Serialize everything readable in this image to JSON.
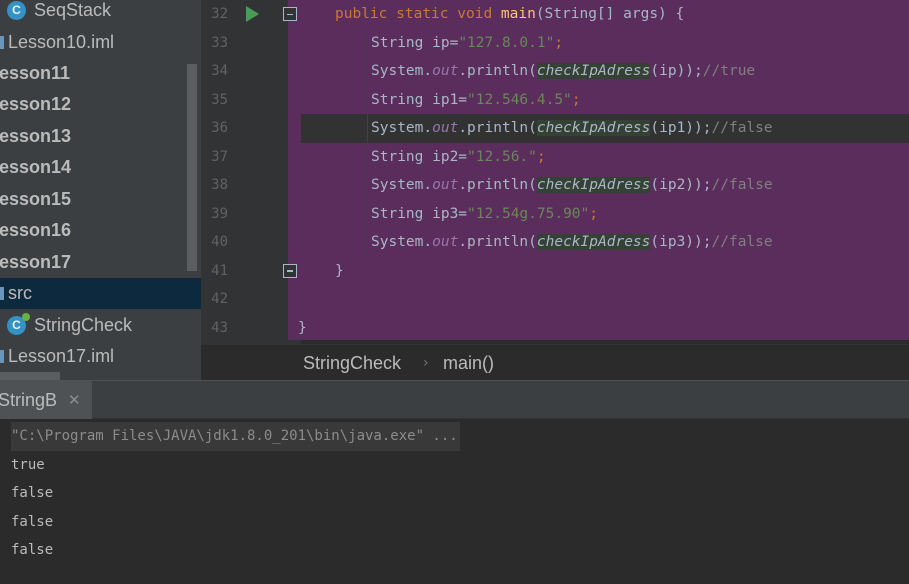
{
  "sidebar": {
    "items": [
      {
        "label": "SeqStack",
        "kind": "class"
      },
      {
        "label": "Lesson10.iml",
        "kind": "file"
      },
      {
        "label": "esson11",
        "kind": "module"
      },
      {
        "label": "esson12",
        "kind": "module"
      },
      {
        "label": "esson13",
        "kind": "module"
      },
      {
        "label": "esson14",
        "kind": "module"
      },
      {
        "label": "esson15",
        "kind": "module"
      },
      {
        "label": "esson16",
        "kind": "module"
      },
      {
        "label": "esson17",
        "kind": "module"
      },
      {
        "label": "src",
        "kind": "folder",
        "selected": true
      },
      {
        "label": "StringCheck",
        "kind": "class"
      },
      {
        "label": "Lesson17.iml",
        "kind": "file"
      }
    ],
    "class_icon_letter": "C"
  },
  "editor": {
    "line_numbers": [
      "32",
      "33",
      "34",
      "35",
      "36",
      "37",
      "38",
      "39",
      "40",
      "41",
      "42",
      "43"
    ],
    "tokens": {
      "public": "public",
      "static": "static",
      "void": "void",
      "main": "main",
      "main_params": "(String[] args) {",
      "string_type": "String",
      "system": "System.",
      "out": "out",
      "println": ".println(",
      "check": "checkIpAdress",
      "lines": {
        "l33_var": " ip=",
        "l33_str": "\"127.8.0.1\"",
        "l35_var": " ip1=",
        "l35_str": "\"12.546.4.5\"",
        "l37_var": " ip2=",
        "l37_str": "\"12.56.\"",
        "l39_var": " ip3=",
        "l39_str": "\"12.54g.75.90\"",
        "semicolon": ";",
        "l34_arg": "(ip));",
        "l34_cmt": "//true",
        "l36_arg": "(ip1));",
        "l36_cmt": "//false",
        "l38_arg": "(ip2));",
        "l38_cmt": "//false",
        "l40_arg": "(ip3));",
        "l40_cmt": "//false",
        "close_brace": "}"
      }
    }
  },
  "breadcrumb": {
    "file": "StringCheck",
    "separator": "›",
    "method": "main()"
  },
  "run_panel": {
    "tab_label": "StringB",
    "close_glyph": "✕",
    "command": "\"C:\\Program Files\\JAVA\\jdk1.8.0_201\\bin\\java.exe\" ...",
    "output": [
      "true",
      "false",
      "false",
      "false"
    ]
  },
  "colors": {
    "purple_highlight": "#5a2d5c",
    "keyword": "#cc7832",
    "string": "#6a8759",
    "comment": "#808080",
    "field": "#9876aa",
    "function": "#ffc66d",
    "selected_row": "#0d293e"
  }
}
